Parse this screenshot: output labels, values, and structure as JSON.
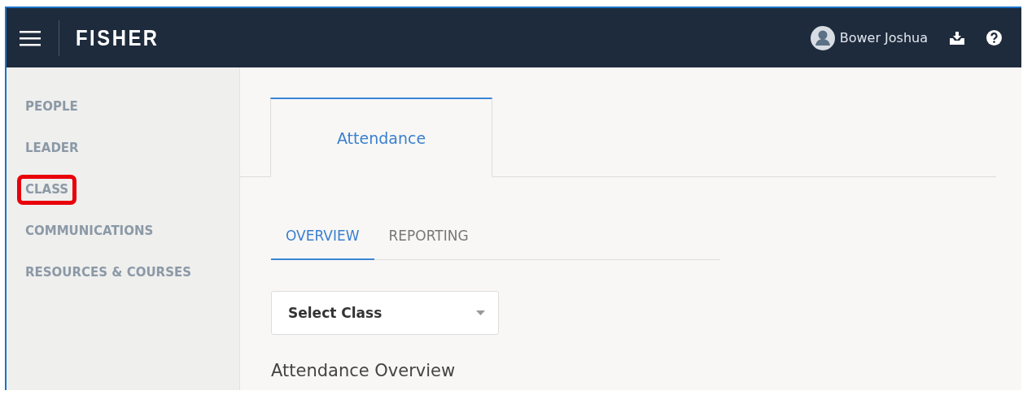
{
  "header": {
    "logo": "FISHER",
    "user_name": "Bower Joshua"
  },
  "sidebar": {
    "items": [
      {
        "label": "PEOPLE",
        "highlighted": false
      },
      {
        "label": "LEADER",
        "highlighted": false
      },
      {
        "label": "CLASS",
        "highlighted": true
      },
      {
        "label": "COMMUNICATIONS",
        "highlighted": false
      },
      {
        "label": "RESOURCES & COURSES",
        "highlighted": false
      }
    ]
  },
  "tabs": [
    {
      "label": "Attendance",
      "selected": true
    }
  ],
  "subtabs": [
    {
      "label": "OVERVIEW",
      "selected": true
    },
    {
      "label": "REPORTING",
      "selected": false
    }
  ],
  "class_select": {
    "value": "Select Class"
  },
  "section_title": "Attendance Overview"
}
